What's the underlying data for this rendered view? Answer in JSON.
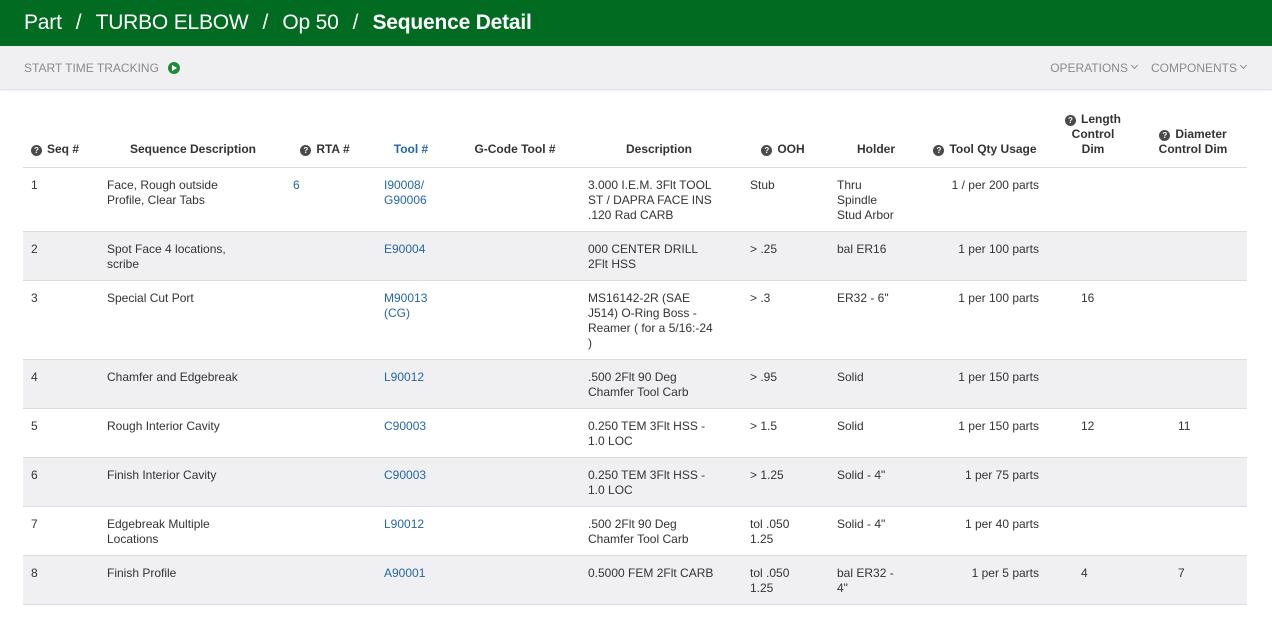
{
  "breadcrumb": {
    "part": "Part",
    "name": "TURBO ELBOW",
    "op": "Op 50",
    "page": "Sequence Detail",
    "sep": "/"
  },
  "toolbar": {
    "time_tracking": "START TIME TRACKING",
    "operations": "OPERATIONS",
    "components": "COMPONENTS"
  },
  "colors": {
    "header_bg": "#006b21",
    "link": "#2566a8",
    "alt_row": "#f0f0f2"
  },
  "table": {
    "headers": {
      "seq": "Seq #",
      "desc": "Sequence Description",
      "rta": "RTA #",
      "tool": "Tool #",
      "gcode": "G-Code Tool #",
      "description": "Description",
      "ooh": "OOH",
      "holder": "Holder",
      "qty": "Tool Qty Usage",
      "length": "Length Control Dim",
      "diameter": "Diameter Control Dim"
    },
    "rows": [
      {
        "seq": "1",
        "desc": "Face, Rough outside Profile, Clear Tabs",
        "rta": "6",
        "tool": "I90008/ G90006",
        "gcode": "",
        "description": "3.000 I.E.M. 3Flt TOOL ST   / DAPRA FACE INS .120 Rad CARB",
        "ooh": "Stub",
        "holder": "Thru Spindle Stud Arbor",
        "qty": "1 / per 200 parts",
        "length": "",
        "diameter": ""
      },
      {
        "seq": "2",
        "desc": "Spot Face 4 locations, scribe",
        "rta": "",
        "tool": "E90004",
        "gcode": "",
        "description": "000 CENTER DRILL 2Flt HSS",
        "ooh": "> .25",
        "holder": "bal ER16",
        "qty": "1 per 100 parts",
        "length": "",
        "diameter": ""
      },
      {
        "seq": "3",
        "desc": "Special Cut Port",
        "rta": "",
        "tool": "M90013 (CG)",
        "gcode": "",
        "description": "MS16142-2R (SAE J514) O-Ring Boss - Reamer ( for a 5/16:-24 )",
        "ooh": "> .3",
        "holder": "ER32 - 6\"",
        "qty": "1 per 100 parts",
        "length": "16",
        "diameter": ""
      },
      {
        "seq": "4",
        "desc": "Chamfer and Edgebreak",
        "rta": "",
        "tool": "L90012",
        "gcode": "",
        "description": ".500 2Flt 90 Deg Chamfer Tool Carb",
        "ooh": "> .95",
        "holder": "Solid",
        "qty": "1 per 150 parts",
        "length": "",
        "diameter": ""
      },
      {
        "seq": "5",
        "desc": "Rough Interior Cavity",
        "rta": "",
        "tool": "C90003",
        "gcode": "",
        "description": "0.250 TEM 3Flt HSS - 1.0 LOC",
        "ooh": "> 1.5",
        "holder": "Solid",
        "qty": "1 per 150 parts",
        "length": "12",
        "diameter": "11"
      },
      {
        "seq": "6",
        "desc": "Finish Interior Cavity",
        "rta": "",
        "tool": "C90003",
        "gcode": "",
        "description": "0.250 TEM 3Flt HSS - 1.0 LOC",
        "ooh": "> 1.25",
        "holder": "Solid - 4\"",
        "qty": "1 per 75 parts",
        "length": "",
        "diameter": ""
      },
      {
        "seq": "7",
        "desc": "Edgebreak Multiple Locations",
        "rta": "",
        "tool": "L90012",
        "gcode": "",
        "description": ".500 2Flt 90 Deg Chamfer Tool Carb",
        "ooh": "tol .050 1.25",
        "holder": "Solid - 4\"",
        "qty": "1 per 40 parts",
        "length": "",
        "diameter": ""
      },
      {
        "seq": "8",
        "desc": "Finish Profile",
        "rta": "",
        "tool": "A90001",
        "gcode": "",
        "description": "0.5000 FEM 2Flt CARB",
        "ooh": "tol .050 1.25",
        "holder": "bal ER32 - 4\"",
        "qty": "1 per 5 parts",
        "length": "4",
        "diameter": "7"
      }
    ]
  }
}
